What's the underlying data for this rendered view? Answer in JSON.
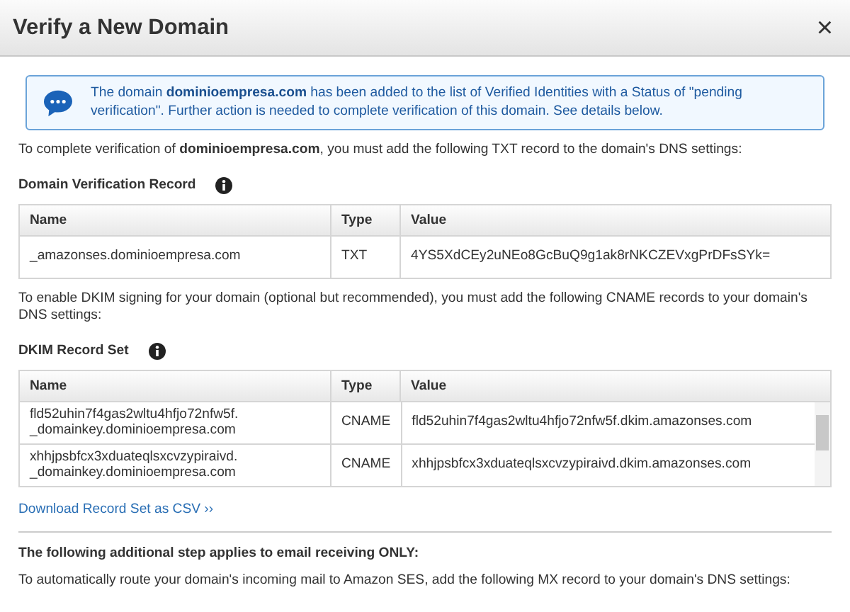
{
  "window": {
    "title": "Verify a New Domain",
    "close": "×"
  },
  "notice": "The domain **dominioempresa.com** has been added to the list of Verified Identities with a Status of \"pending verification\". Further action is needed to complete verification of this domain. See details below.",
  "intro": "To complete verification of **dominioempresa.com**, you must add the following TXT record to the domain's DNS settings:",
  "verification": {
    "title": "Domain Verification Record",
    "columns": [
      "Name",
      "Type",
      "Value"
    ],
    "rows": [
      {
        "name": "_amazonses.dominioempresa.com",
        "type": "TXT",
        "value": "4YS5XdCEy2uNEo8GcBuQ9g1ak8rNKCZEVxgPrDFsSYk="
      }
    ]
  },
  "dkim_intro": "To enable DKIM signing for your domain (optional but recommended), you must add the following CNAME records to your domain's DNS settings:",
  "dkim": {
    "title": "DKIM Record Set",
    "columns": [
      "Name",
      "Type",
      "Value"
    ],
    "rows": [
      {
        "name": "fld52uhin7f4gas2wltu4hfjo72nfw5f.\n_domainkey.dominioempresa.com",
        "type": "CNAME",
        "value": "fld52uhin7f4gas2wltu4hfjo72nfw5f.dkim.amazonses.com"
      },
      {
        "name": "xhhjpsbfcx3xduateqlsxcvzypiraivd.\n_domainkey.dominioempresa.com",
        "type": "CNAME",
        "value": "xhhjpsbfcx3xduateqlsxcvzypiraivd.dkim.amazonses.com"
      }
    ]
  },
  "download_link": "Download Record Set as CSV ››",
  "receiving_heading": "The following additional step applies to email receiving ONLY:",
  "receiving_text": "To automatically route your domain's incoming mail to Amazon SES, add the following MX record to your domain's DNS settings:"
}
